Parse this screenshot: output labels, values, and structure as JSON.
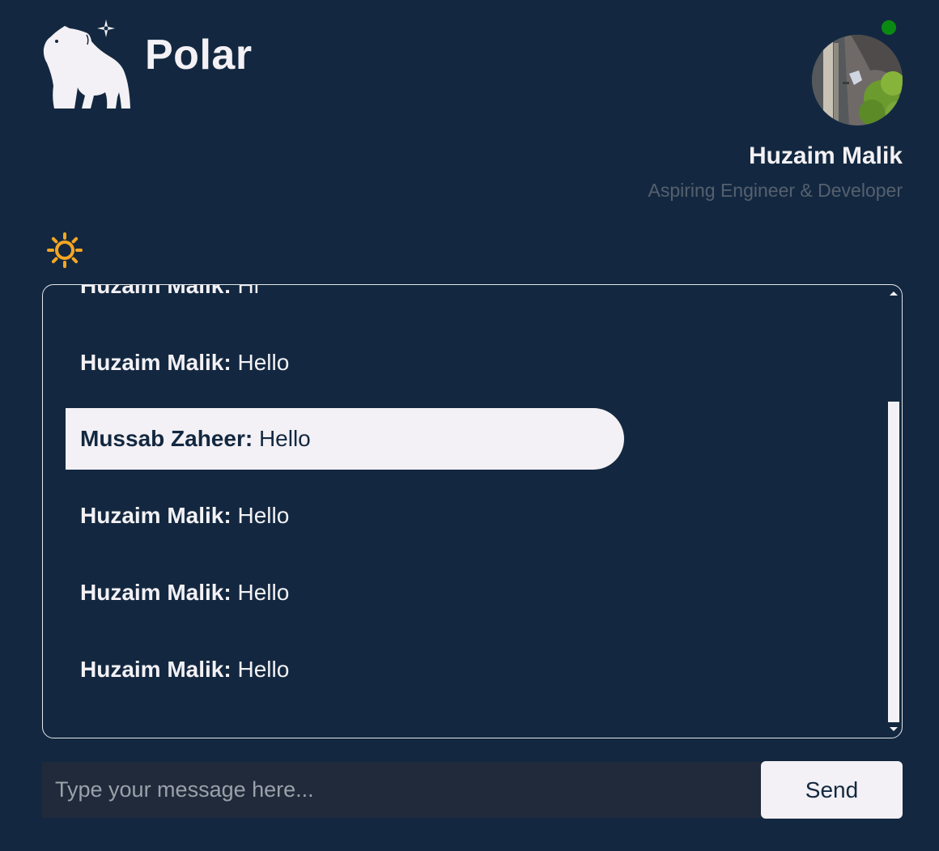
{
  "brand": {
    "name": "Polar",
    "logo_icon": "polar-bear-icon",
    "logo_badge_icon": "sparkle-icon"
  },
  "user": {
    "name": "Huzaim Malik",
    "title": "Aspiring Engineer & Developer",
    "avatar": "avatar-photo",
    "status": "online",
    "status_color": "#0a8a12"
  },
  "theme_toggle": {
    "icon": "sun-icon",
    "color": "#f5a623"
  },
  "chat": {
    "messages": [
      {
        "sender": "Huzaim Malik:",
        "text": " Hi"
      },
      {
        "sender": "Huzaim Malik:",
        "text": " Hello"
      },
      {
        "sender": "Mussab Zaheer:",
        "text": " Hello"
      },
      {
        "sender": "Huzaim Malik:",
        "text": " Hello"
      },
      {
        "sender": "Huzaim Malik:",
        "text": " Hello"
      },
      {
        "sender": "Huzaim Malik:",
        "text": " Hello"
      }
    ]
  },
  "composer": {
    "placeholder": "Type your message here...",
    "value": "",
    "send_label": "Send"
  },
  "colors": {
    "background": "#132840",
    "highlight_bubble": "#f3f1f5",
    "input_background": "#202a3a"
  }
}
